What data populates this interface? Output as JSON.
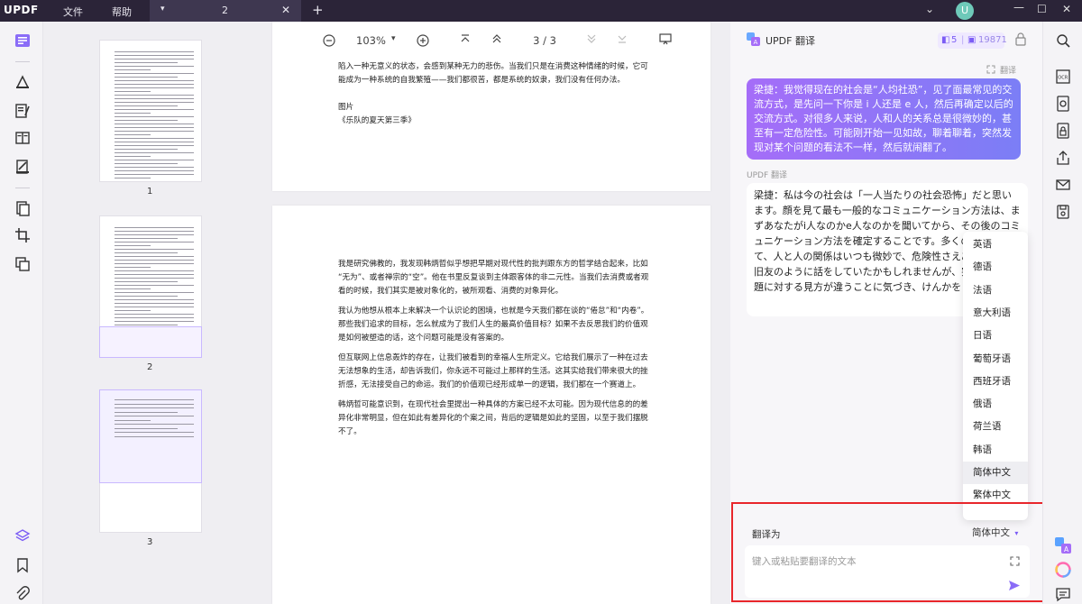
{
  "titlebar": {
    "app_name": "UPDF",
    "menu": [
      "文件",
      "帮助"
    ],
    "tab_name": "2",
    "avatar_letter": "U"
  },
  "viewer_toolbar": {
    "zoom": "103%",
    "page_current": "3",
    "page_separator": "/",
    "page_total": "3"
  },
  "thumbnails": {
    "labels": [
      "1",
      "2",
      "3"
    ]
  },
  "page_top": {
    "lines": [
      "陷入一种无意义的状态，会感到某种无力的悲伤。当我们只是在消费这种情绪的时候，它可",
      "能成为一种系统的自我繁殖——我们都很苦，都是系统的奴隶，我们没有任何办法。",
      "",
      "图片",
      "《乐队的夏天第三季》"
    ]
  },
  "page_main": {
    "paragraphs": [
      [
        "我是研究佛教的，我发现韩炳哲似乎想把早期对现代性的批判跟东方的哲学结合起来，比如",
        "“无为”、或者禅宗的“空”。他在书里反复谈到主体跟客体的非二元性。当我们去消费或者观",
        "看的时候，我们其实是被对象化的，被所观看、消费的对象异化。"
      ],
      [
        "我认为他想从根本上来解决一个认识论的困境，也就是今天我们都在谈的“倦怠”和“内卷”。",
        "那些我们追求的目标，怎么就成为了我们人生的最高价值目标？如果不去反思我们的价值观",
        "是如何被塑造的话，这个问题可能是没有答案的。"
      ],
      [
        "但互联网上信息轰炸的存在，让我们被看到的幸福人生所定义。它给我们展示了一种在过去",
        "无法想象的生活，却告诉我们，你永远不可能过上那样的生活。这其实给我们带来很大的挫",
        "折感，无法接受自己的命运。我们的价值观已经形成单一的逻辑，我们都在一个赛道上。"
      ],
      [
        "韩炳哲可能意识到，在现代社会里提出一种具体的方案已经不太可能。因为现代信息的的差",
        "异化非常明显，但在如此有差异化的个案之间，背后的逻辑是如此的坚固，以至于我们摆脱",
        "不了。"
      ]
    ]
  },
  "panel": {
    "title": "UPDF 翻译",
    "badge_left": "5",
    "badge_right": "19871",
    "user_tag": "翻译",
    "user_message": "梁捷：我觉得现在的社会是“人均社恐”，见了面最常见的交流方式，是先问一下你是 i 人还是 e 人，然后再确定以后的交流方式。对很多人来说，人和人的关系总是很微妙的，甚至有一定危险性。可能刚开始一见如故，聊着聊着，突然发现对某个问题的看法不一样，然后就闹翻了。",
    "ai_label": "UPDF 翻译",
    "ai_message": "梁捷：私は今の社会は「一人当たりの社会恐怖」だと思います。顔を見て最も一般的なコミュニケーション方法は、まずあなたがi人なのかe人なのかを聞いてから、その後のコミュニケーション方法を確定することです。多くの人にとって、人と人の関係はいつも微妙で、危険性さえある。最初は旧友のように話をしていたかもしれませんが、突然ある問題に対する見方が違うことに気づき、けんかをしてしまう。",
    "translate_to_label": "翻译为",
    "translate_to_value": "简体中文",
    "input_placeholder": "键入或粘贴要翻译的文本"
  },
  "language_dropdown": {
    "options": [
      "英语",
      "德语",
      "法语",
      "意大利语",
      "日语",
      "葡萄牙语",
      "西班牙语",
      "俄语",
      "荷兰语",
      "韩语",
      "简体中文",
      "繁体中文"
    ],
    "selected": "简体中文"
  },
  "colors": {
    "titlebar_bg": "#2b2438",
    "accent_purple": "#8a6cf7",
    "highlight_red": "#e8262b"
  },
  "icons": {
    "left_sidebar": [
      "reader-icon",
      "comment-icon",
      "edit-text-icon",
      "page-layout-icon",
      "fill-sign-icon",
      "organize-pages-icon",
      "crop-icon",
      "convert-icon",
      "layers-icon",
      "bookmark-icon",
      "attachment-icon"
    ],
    "right_sidebar": [
      "search-icon",
      "ocr-icon",
      "convert-icon",
      "protect-icon",
      "share-icon",
      "mail-icon",
      "save-icon",
      "ai-translate-icon",
      "updf-ai-icon",
      "chat-icon"
    ]
  }
}
